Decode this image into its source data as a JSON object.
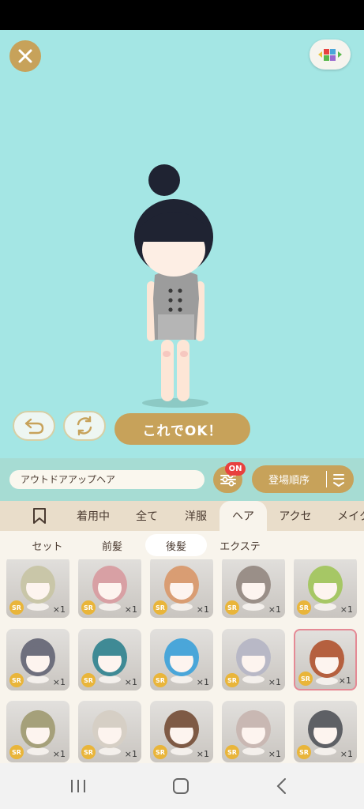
{
  "stage": {
    "background": "#a4e6e4"
  },
  "buttons": {
    "ok_label": "これでOK！"
  },
  "outfit": {
    "name": "アウトドアアップヘア",
    "filter_badge": "ON",
    "sort_label": "登場順序"
  },
  "tabs": [
    {
      "label": "",
      "icon": "bookmark-icon"
    },
    {
      "label": "着用中"
    },
    {
      "label": "全て"
    },
    {
      "label": "洋服"
    },
    {
      "label": "ヘア",
      "active": true
    },
    {
      "label": "アクセ"
    },
    {
      "label": "メイク"
    }
  ],
  "subtabs": [
    {
      "label": "セット"
    },
    {
      "label": "前髪"
    },
    {
      "label": "後髪",
      "active": true
    },
    {
      "label": "エクステ"
    }
  ],
  "items": [
    {
      "rarity": "SR",
      "count": "×1",
      "hair": "#c9c6a8",
      "style": "buns-flowers"
    },
    {
      "rarity": "SR",
      "count": "×1",
      "hair": "#d8a0a4",
      "style": "side-bow"
    },
    {
      "rarity": "SR",
      "count": "×1",
      "hair": "#d99d73",
      "style": "orange-buns"
    },
    {
      "rarity": "SR",
      "count": "×1",
      "hair": "#9a8f88",
      "style": "braid"
    },
    {
      "rarity": "SR",
      "count": "×1",
      "hair": "#a6c765",
      "style": "green-streak"
    },
    {
      "rarity": "SR",
      "count": "×1",
      "hair": "#6e6f7d",
      "style": "long-straight"
    },
    {
      "rarity": "SR",
      "count": "×1",
      "hair": "#3f8a95",
      "style": "teal-curls"
    },
    {
      "rarity": "SR",
      "count": "×1",
      "hair": "#4aa6d9",
      "style": "blue-long"
    },
    {
      "rarity": "SR",
      "count": "×1",
      "hair": "#b8b8c6",
      "style": "twintails"
    },
    {
      "rarity": "SR",
      "count": "×1",
      "hair": "#b5603f",
      "style": "bun",
      "selected": true
    },
    {
      "rarity": "SR",
      "count": "×1",
      "hair": "#a5a07a",
      "style": "braids-flowers"
    },
    {
      "rarity": "SR",
      "count": "×1",
      "hair": "#d6cfc5",
      "style": "long-wavy"
    },
    {
      "rarity": "SR",
      "count": "×1",
      "hair": "#7e5a45",
      "style": "brown-braids"
    },
    {
      "rarity": "SR",
      "count": "×1",
      "hair": "#c9b8b3",
      "style": "pink-bob"
    },
    {
      "rarity": "SR",
      "count": "×1",
      "hair": "#5e6065",
      "style": "short-dark"
    }
  ]
}
